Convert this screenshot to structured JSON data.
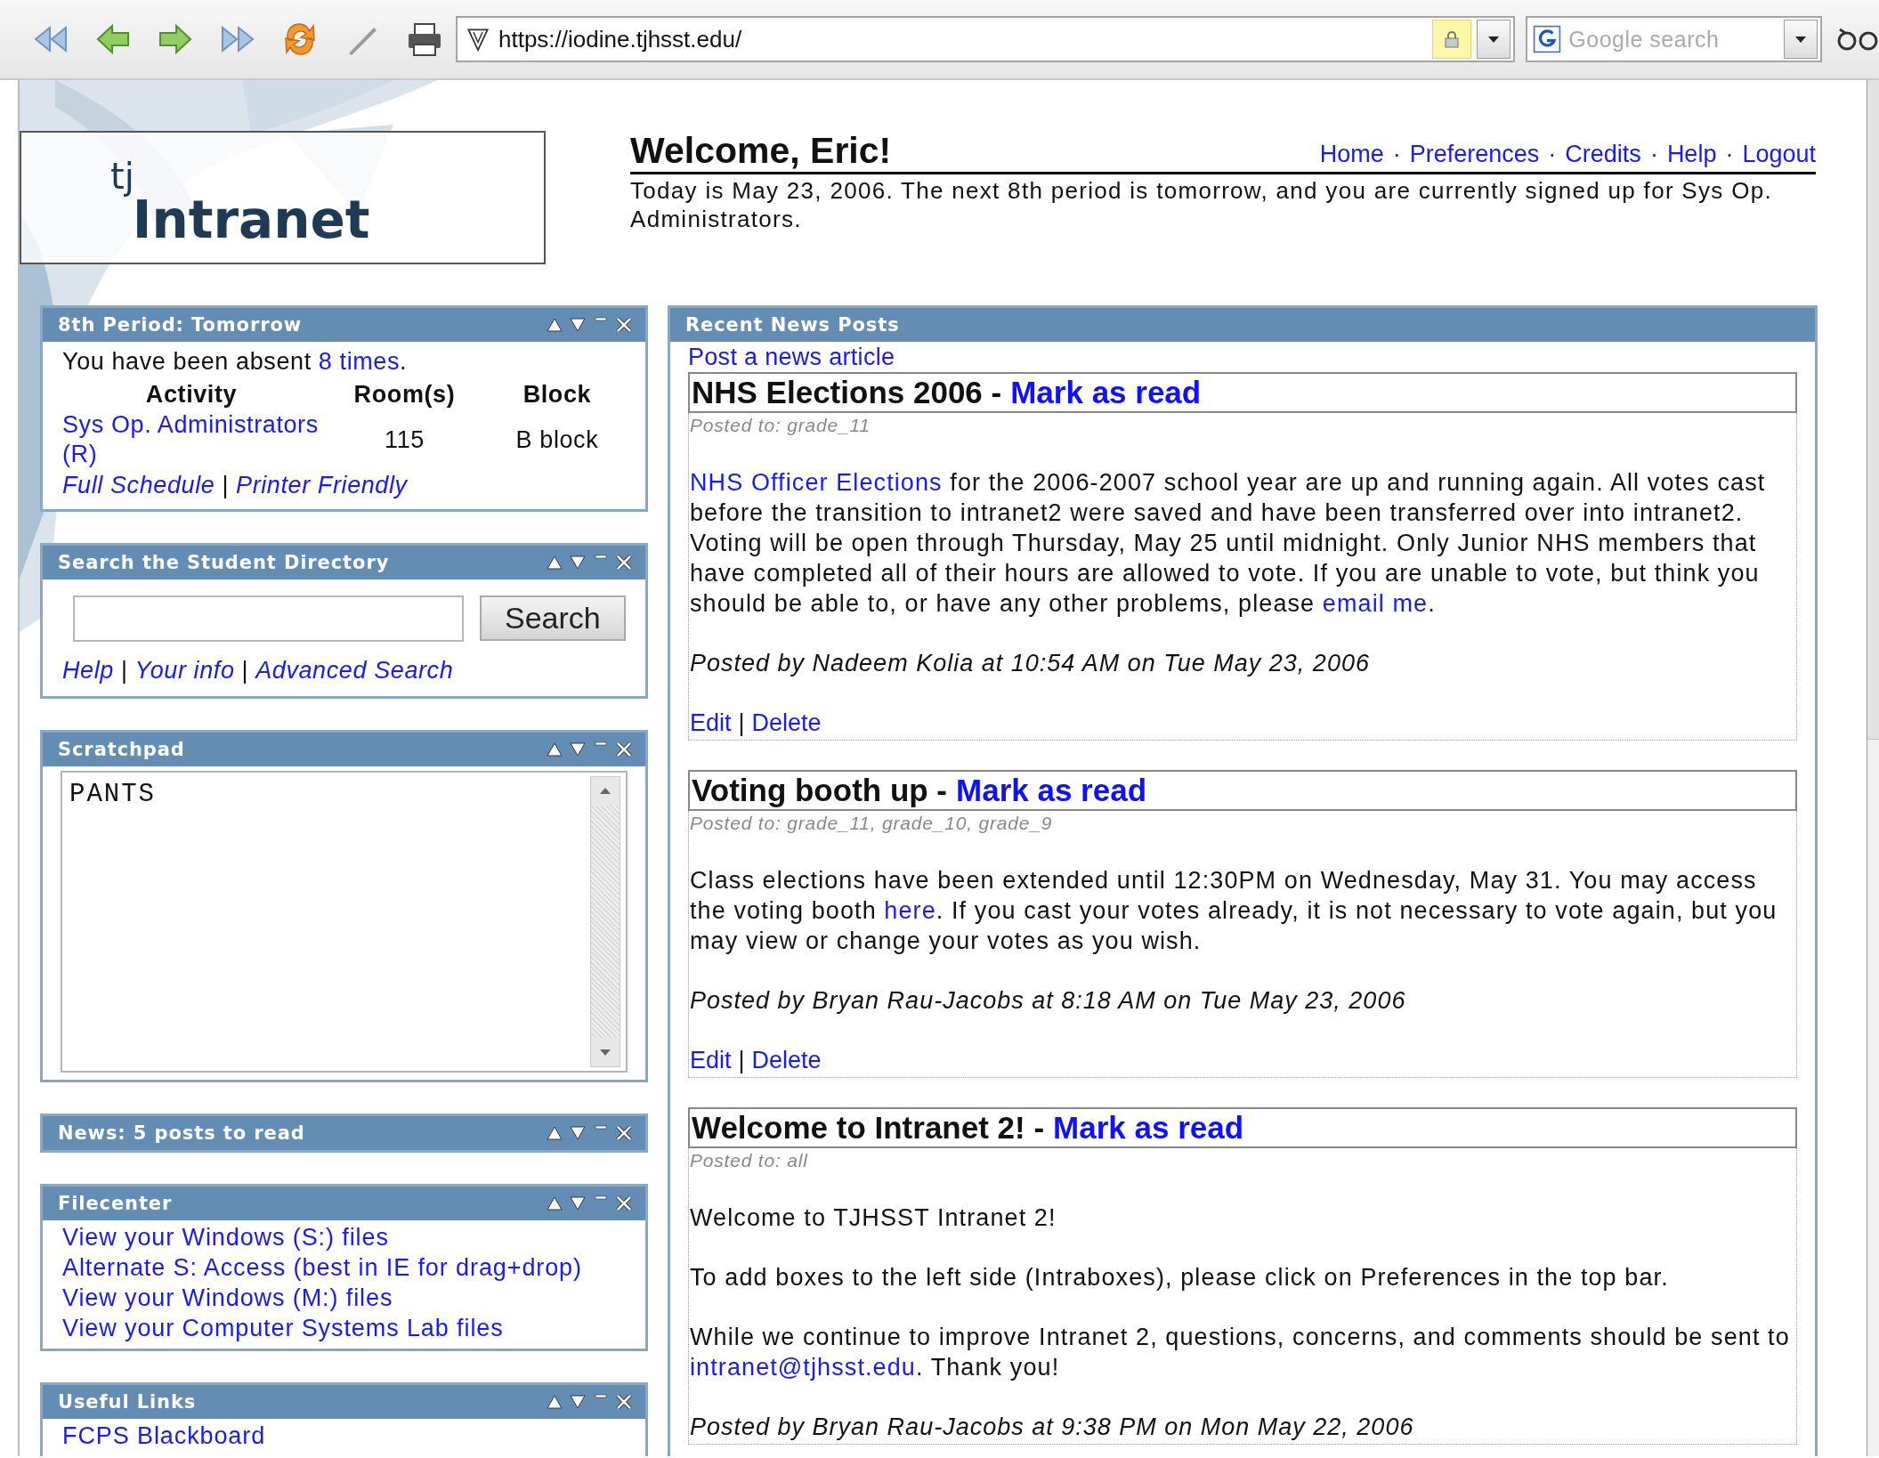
{
  "browser": {
    "url": "https://iodine.tjhsst.edu/",
    "search_placeholder": "Google search"
  },
  "logo": {
    "superscript": "tj",
    "name": "Intranet"
  },
  "header": {
    "welcome": "Welcome, Eric!",
    "separator": "·",
    "links": [
      "Home",
      "Preferences",
      "Credits",
      "Help",
      "Logout"
    ],
    "message": "Today is May 23, 2006. The next 8th period is tomorrow, and you are currently signed up for Sys Op. Administrators."
  },
  "intraboxes": [
    {
      "kind": "schedule",
      "title": "8th Period: Tomorrow",
      "absence": [
        {
          "text": "You have been absent ",
          "kind": "text"
        },
        {
          "text": "8 times",
          "kind": "link"
        },
        {
          "text": ".",
          "kind": "text"
        }
      ],
      "columns": [
        "Activity",
        "Room(s)",
        "Block"
      ],
      "rows": [
        {
          "activity": "Sys Op. Administrators (R)",
          "room": "115",
          "block": "B block"
        }
      ],
      "links": [
        "Full Schedule",
        "Printer Friendly"
      ],
      "separator": "|"
    },
    {
      "kind": "search",
      "title": "Search the Student Directory",
      "button": "Search",
      "links": [
        "Help",
        "Your info",
        "Advanced Search"
      ],
      "separator": "|"
    },
    {
      "kind": "scratchpad",
      "title": "Scratchpad",
      "text": "PANTS"
    },
    {
      "kind": "collapsed",
      "title": "News: 5 posts to read"
    },
    {
      "kind": "links",
      "title": "Filecenter",
      "links": [
        "View your Windows (S:) files",
        "Alternate S: Access (best in IE for drag+drop)",
        "View your Windows (M:) files",
        "View your Computer Systems Lab files"
      ]
    },
    {
      "kind": "links",
      "title": "Useful Links",
      "links": [
        "FCPS Blackboard"
      ]
    }
  ],
  "news": {
    "title": "Recent News Posts",
    "post_link": "Post a news article",
    "posts": [
      {
        "title": "NHS Elections 2006",
        "separator": "-",
        "mark_read": "Mark as read",
        "posted_to": "Posted to: grade_11",
        "paragraphs": [
          [
            {
              "text": "NHS Officer Elections",
              "kind": "link"
            },
            {
              "text": " for the 2006-2007 school year are up and running again. All votes cast before the transition to intranet2 were saved and have been transferred over into intranet2. Voting will be open through Thursday, May 25 until midnight. Only Junior NHS members that have completed all of their hours are allowed to vote. If you are unable to vote, but think you should be able to, or have any other problems, please ",
              "kind": "text"
            },
            {
              "text": "email me",
              "kind": "link"
            },
            {
              "text": ".",
              "kind": "text"
            }
          ]
        ],
        "byline": "Posted by Nadeem Kolia at 10:54 AM on Tue May 23, 2006",
        "actions": [
          "Edit",
          "Delete"
        ],
        "action_separator": "|"
      },
      {
        "title": "Voting booth up",
        "separator": "-",
        "mark_read": "Mark as read",
        "posted_to": "Posted to: grade_11, grade_10, grade_9",
        "paragraphs": [
          [
            {
              "text": "Class elections have been extended until 12:30PM on Wednesday, May 31. You may access the voting booth ",
              "kind": "text"
            },
            {
              "text": "here",
              "kind": "link"
            },
            {
              "text": ". If you cast your votes already, it is not necessary to vote again, but you may view or change your votes as you wish.",
              "kind": "text"
            }
          ]
        ],
        "byline": "Posted by Bryan Rau-Jacobs at 8:18 AM on Tue May 23, 2006",
        "actions": [
          "Edit",
          "Delete"
        ],
        "action_separator": "|"
      },
      {
        "title": "Welcome to Intranet 2!",
        "separator": "-",
        "mark_read": "Mark as read",
        "posted_to": "Posted to: all",
        "paragraphs": [
          [
            {
              "text": "Welcome to TJHSST Intranet 2!",
              "kind": "text"
            }
          ],
          [
            {
              "text": "To add boxes to the left side (Intraboxes), please click on Preferences in the top bar.",
              "kind": "text"
            }
          ],
          [
            {
              "text": "While we continue to improve Intranet 2, questions, concerns, and comments should be sent to ",
              "kind": "text"
            },
            {
              "text": "intranet@tjhsst.edu",
              "kind": "link"
            },
            {
              "text": ". Thank you!",
              "kind": "text"
            }
          ]
        ],
        "byline": "Posted by Bryan Rau-Jacobs at 9:38 PM on Mon May 22, 2006"
      }
    ]
  }
}
